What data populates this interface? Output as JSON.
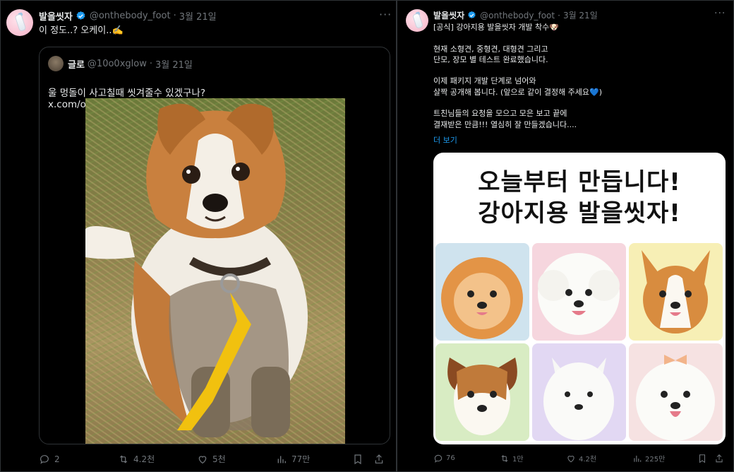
{
  "tweet_left": {
    "author": {
      "name": "발을씻자",
      "handle": "@onthebody_foot",
      "date": "3월 21일"
    },
    "text": "이 정도..? 오케이..✍️",
    "quote": {
      "author": {
        "name": "글로",
        "handle": "@10o0xglow",
        "date": "3월 21일"
      },
      "text": "울 멍돌이 사고칠때 씻겨줄수 있겠구나?",
      "link": "x.com/onthebody_foot..."
    },
    "actions": {
      "replies": "2",
      "retweets": "4.2천",
      "likes": "5천",
      "views": "77만"
    }
  },
  "tweet_right": {
    "author": {
      "name": "발을씻자",
      "handle": "@onthebody_foot",
      "date": "3월 21일"
    },
    "text": "[공식] 강아지용 발을씻자 개발 착수🐶\n\n현재 소형견, 중형견, 대형견 그리고\n단모, 장모 별 테스트 완료했습니다.\n\n이제 패키지 개발 단계로 넘어와\n살짝 공개해 봅니다. (앞으로 같이 결정해 주세요💙)\n\n트친님들의 요청을 모으고 모은 보고 끝에\n결재받은 만큼!!! 열심히 잘 만들겠습니다....",
    "more_label": "더 보기",
    "promo": {
      "line1": "오늘부터 만듭니다!",
      "line2": "강아지용 발을씻자!"
    },
    "actions": {
      "replies": "76",
      "retweets": "1만",
      "likes": "4.2천",
      "views": "225만"
    }
  },
  "colors": {
    "bg": "#000000",
    "text": "#e7e9ea",
    "muted": "#71767b",
    "verified": "#1d9bf0",
    "border": "#2f3336"
  }
}
